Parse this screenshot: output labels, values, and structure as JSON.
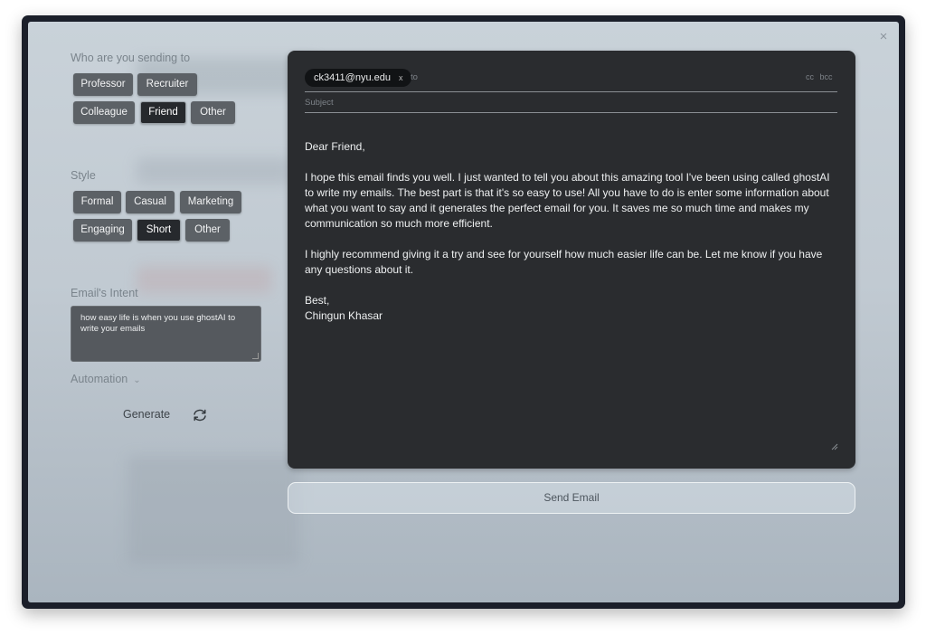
{
  "close_label": "×",
  "recipient_section": {
    "label": "Who are you sending to",
    "options": [
      "Professor",
      "Recruiter",
      "Colleague",
      "Friend",
      "Other"
    ],
    "selected": "Friend"
  },
  "style_section": {
    "label": "Style",
    "options": [
      "Formal",
      "Casual",
      "Marketing",
      "Engaging",
      "Short",
      "Other"
    ],
    "selected": "Short"
  },
  "intent_section": {
    "label": "Email's Intent",
    "value": "how easy life is when you use ghostAI to write your emails"
  },
  "automation": {
    "label": "Automation",
    "chevron": "⌄"
  },
  "generate": {
    "label": "Generate",
    "icon": "refresh-icon"
  },
  "compose": {
    "recipient": "ck3411@nyu.edu",
    "recipient_remove": "x",
    "to_label": "to",
    "cc_label": "cc",
    "bcc_label": "bcc",
    "subject_placeholder": "Subject",
    "body": {
      "greeting": "Dear Friend,",
      "paragraph1": "I hope this email finds you well. I just wanted to tell you about this amazing tool I've been using called ghostAI to write my emails. The best part is that it's so easy to use! All you have to do is enter some information about what you want to say and it generates the perfect email for you. It saves me so much time and makes my communication so much more efficient.",
      "paragraph2": "I highly recommend giving it a try and see for yourself how much easier life can be. Let me know if you have any questions about it.",
      "closing": "Best,",
      "signature": "Chingun Khasar"
    }
  },
  "send_button": {
    "label": "Send Email"
  }
}
